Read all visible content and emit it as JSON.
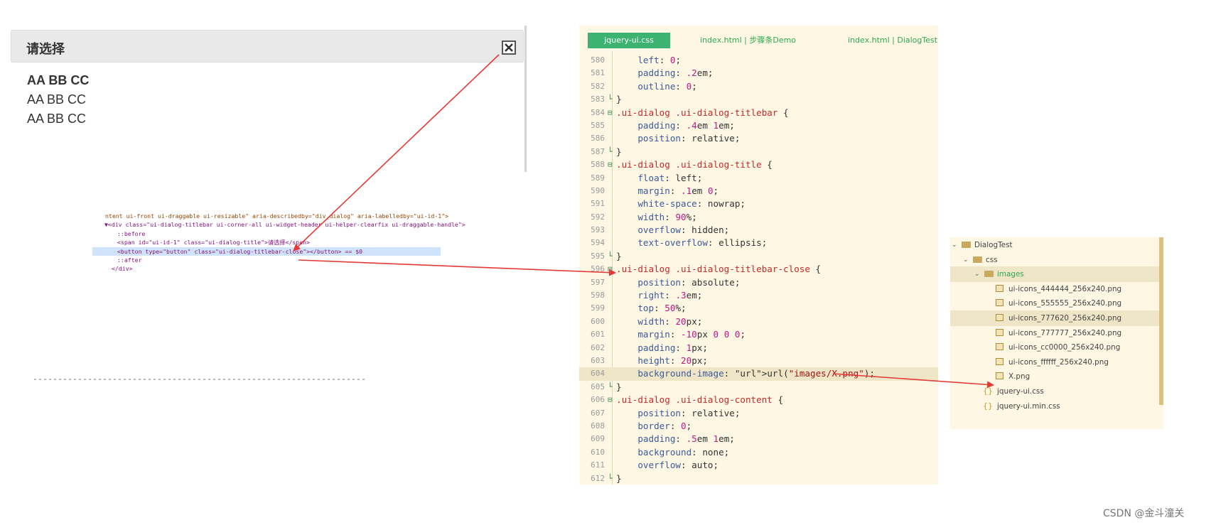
{
  "dialog": {
    "title": "请选择",
    "close_label": "×",
    "lines": [
      "AA BB CC",
      "AA BB CC",
      "AA BB CC"
    ]
  },
  "devtools": {
    "lines": [
      "ntent ui-front ui-draggable ui-resizable\" aria-describedby=\"div_dialog\" aria-labelledby=\"ui-id-1\">",
      "▼<div class=\"ui-dialog-titlebar ui-corner-all ui-widget-header ui-helper-clearfix ui-draggable-handle\">",
      "::before",
      "<span id=\"ui-id-1\" class=\"ui-dialog-title\">请选择</span>",
      "<button type=\"button\" class=\"ui-dialog-titlebar-close\"></button> == $0",
      "::after",
      "</div>"
    ]
  },
  "editor": {
    "tabs": [
      "jquery-ui.css",
      "index.html | 步骤条Demo",
      "index.html | DialogTest"
    ],
    "lines": [
      {
        "n": "580",
        "fold": "",
        "code": "    left: 0;"
      },
      {
        "n": "581",
        "fold": "",
        "code": "    padding: .2em;"
      },
      {
        "n": "582",
        "fold": "",
        "code": "    outline: 0;"
      },
      {
        "n": "583",
        "fold": "└",
        "code": "}"
      },
      {
        "n": "584",
        "fold": "⊟",
        "code": ".ui-dialog .ui-dialog-titlebar {"
      },
      {
        "n": "585",
        "fold": "",
        "code": "    padding: .4em 1em;"
      },
      {
        "n": "586",
        "fold": "",
        "code": "    position: relative;"
      },
      {
        "n": "587",
        "fold": "└",
        "code": "}"
      },
      {
        "n": "588",
        "fold": "⊟",
        "code": ".ui-dialog .ui-dialog-title {"
      },
      {
        "n": "589",
        "fold": "",
        "code": "    float: left;"
      },
      {
        "n": "590",
        "fold": "",
        "code": "    margin: .1em 0;"
      },
      {
        "n": "591",
        "fold": "",
        "code": "    white-space: nowrap;"
      },
      {
        "n": "592",
        "fold": "",
        "code": "    width: 90%;"
      },
      {
        "n": "593",
        "fold": "",
        "code": "    overflow: hidden;"
      },
      {
        "n": "594",
        "fold": "",
        "code": "    text-overflow: ellipsis;"
      },
      {
        "n": "595",
        "fold": "└",
        "code": "}"
      },
      {
        "n": "596",
        "fold": "⊟",
        "code": ".ui-dialog .ui-dialog-titlebar-close {"
      },
      {
        "n": "597",
        "fold": "",
        "code": "    position: absolute;"
      },
      {
        "n": "598",
        "fold": "",
        "code": "    right: .3em;"
      },
      {
        "n": "599",
        "fold": "",
        "code": "    top: 50%;"
      },
      {
        "n": "600",
        "fold": "",
        "code": "    width: 20px;"
      },
      {
        "n": "601",
        "fold": "",
        "code": "    margin: -10px 0 0 0;"
      },
      {
        "n": "602",
        "fold": "",
        "code": "    padding: 1px;"
      },
      {
        "n": "603",
        "fold": "",
        "code": "    height: 20px;"
      },
      {
        "n": "604",
        "fold": "",
        "code": "    background-image: url(\"images/X.png\");"
      },
      {
        "n": "605",
        "fold": "└",
        "code": "}"
      },
      {
        "n": "606",
        "fold": "⊟",
        "code": ".ui-dialog .ui-dialog-content {"
      },
      {
        "n": "607",
        "fold": "",
        "code": "    position: relative;"
      },
      {
        "n": "608",
        "fold": "",
        "code": "    border: 0;"
      },
      {
        "n": "609",
        "fold": "",
        "code": "    padding: .5em 1em;"
      },
      {
        "n": "610",
        "fold": "",
        "code": "    background: none;"
      },
      {
        "n": "611",
        "fold": "",
        "code": "    overflow: auto;"
      },
      {
        "n": "612",
        "fold": "└",
        "code": "}"
      }
    ]
  },
  "file_tree": {
    "items": [
      {
        "label": "DialogTest",
        "kind": "folder",
        "expanded": true
      },
      {
        "label": "css",
        "kind": "folder",
        "expanded": true
      },
      {
        "label": "images",
        "kind": "folder",
        "expanded": true
      },
      {
        "label": "ui-icons_444444_256x240.png",
        "kind": "image"
      },
      {
        "label": "ui-icons_555555_256x240.png",
        "kind": "image"
      },
      {
        "label": "ui-icons_777620_256x240.png",
        "kind": "image"
      },
      {
        "label": "ui-icons_777777_256x240.png",
        "kind": "image"
      },
      {
        "label": "ui-icons_cc0000_256x240.png",
        "kind": "image"
      },
      {
        "label": "ui-icons_ffffff_256x240.png",
        "kind": "image"
      },
      {
        "label": "X.png",
        "kind": "image"
      },
      {
        "label": "jquery-ui.css",
        "kind": "css"
      },
      {
        "label": "jquery-ui.min.css",
        "kind": "css"
      }
    ]
  },
  "watermark": "CSDN @金斗潼关",
  "colors": {
    "arrow": "#e53935",
    "editor_bg": "#fdf7e3",
    "active_tab": "#3cb371",
    "selector": "#c82829",
    "property": "#3b5a9a",
    "number": "#c71585"
  }
}
